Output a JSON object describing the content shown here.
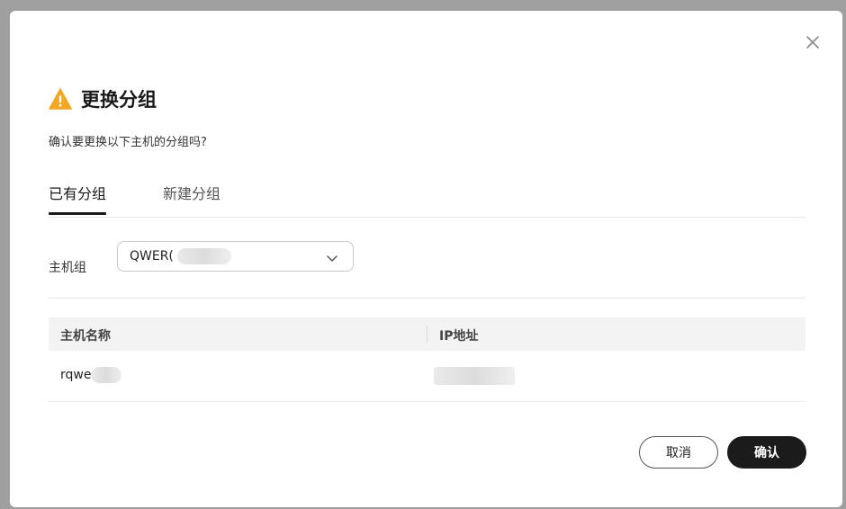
{
  "dialog": {
    "title": "更换分组",
    "subtitle": "确认要更换以下主机的分组吗?",
    "colors": {
      "warning": "#f5a623",
      "primary": "#1b1b1b"
    }
  },
  "tabs": [
    {
      "label": "已有分组",
      "active": true
    },
    {
      "label": "新建分组",
      "active": false
    }
  ],
  "form": {
    "host_group_label": "主机组",
    "host_group_value": "QWER("
  },
  "table": {
    "columns": [
      "主机名称",
      "IP地址"
    ],
    "rows": [
      {
        "host_name": "rqwe",
        "ip": ""
      }
    ]
  },
  "buttons": {
    "cancel": "取消",
    "confirm": "确认"
  },
  "icons": {
    "warning": "warning-icon",
    "close": "close-icon",
    "dropdown": "chevron-down-icon"
  }
}
